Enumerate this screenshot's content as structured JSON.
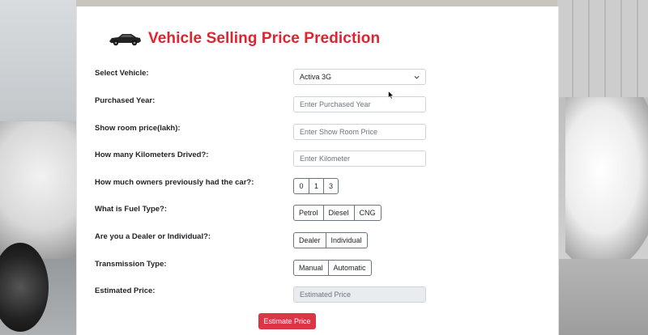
{
  "header": {
    "title": "Vehicle Selling Price Prediction",
    "icon": "car-icon"
  },
  "form": {
    "vehicle": {
      "label": "Select Vehicle:",
      "selected": "Activa 3G"
    },
    "year": {
      "label": "Purchased Year:",
      "placeholder": "Enter Purchased Year"
    },
    "showroom_price": {
      "label": "Show room price(lakh):",
      "placeholder": "Enter Show Room Price"
    },
    "kilometers": {
      "label": "How many Kilometers Drived?:",
      "placeholder": "Enter Kilometer"
    },
    "owners": {
      "label": "How much owners previously had the car?:",
      "options": [
        "0",
        "1",
        "3"
      ]
    },
    "fuel": {
      "label": "What is Fuel Type?:",
      "options": [
        "Petrol",
        "Diesel",
        "CNG"
      ]
    },
    "seller": {
      "label": "Are you a Dealer or Individual?:",
      "options": [
        "Dealer",
        "Individual"
      ]
    },
    "transmission": {
      "label": "Transmission Type:",
      "options": [
        "Manual",
        "Automatic"
      ]
    },
    "estimate": {
      "label": "Estimated Price:",
      "placeholder": "Estimated Price"
    },
    "submit_label": "Estimate Price"
  },
  "colors": {
    "title": "#e0242f",
    "submit": "#dc3545"
  }
}
